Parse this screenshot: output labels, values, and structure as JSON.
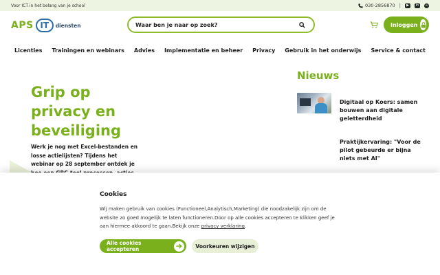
{
  "topbar": {
    "tagline": "Voor ICT in het belang van je school",
    "phone": "030-2856870",
    "separator": "|",
    "social": [
      "youtube-icon",
      "linkedin-icon",
      "spotify-icon"
    ]
  },
  "header": {
    "logo": {
      "aps": "APS",
      "it": "IT",
      "diensten": "diensten"
    },
    "search": {
      "placeholder": "Waar ben je naar op zoek?"
    },
    "login_label": "Inloggen"
  },
  "nav": {
    "items": [
      "Licenties",
      "Trainingen en webinars",
      "Advies",
      "Implementatie en beheer",
      "Privacy",
      "Gebruik in het onderwijs"
    ],
    "right": "Service & contact"
  },
  "hero": {
    "title": "Grip op privacy en beveiliging",
    "text": "Werk je nog met Excel-bestanden en losse actielijsten? Tijdens het webinar op 28 september ontdek je hoe een GRC-tool processen, acties en"
  },
  "news": {
    "heading": "Nieuws",
    "items": [
      {
        "headline": "Digitaal op Koers: samen bouwen aan digitale geletterdheid"
      },
      {
        "headline": "Praktijkervaring: \"Voor de pilot gebeurde er bijna niets met AI\""
      }
    ]
  },
  "cookies": {
    "title": "Cookies",
    "text": "Wij maken gebruik van cookies (Functioneel,Analytisch,Marketing) die noodzakelijk zijn om de website zo goed mogelijk te laten functioneren.Door op alle cookies accepteren te klikken geef je aan hiermee akkoord te gaan.Bekijk onze ",
    "link": "privacy verklaring",
    "link_suffix": ".",
    "accept_label": "Alle cookies accepteren",
    "prefs_label": "Voorkeuren wijzigen"
  },
  "colors": {
    "brand_green": "#7ab01c",
    "brand_blue": "#2d6fa7",
    "topbar_bg": "#eef4e2"
  }
}
